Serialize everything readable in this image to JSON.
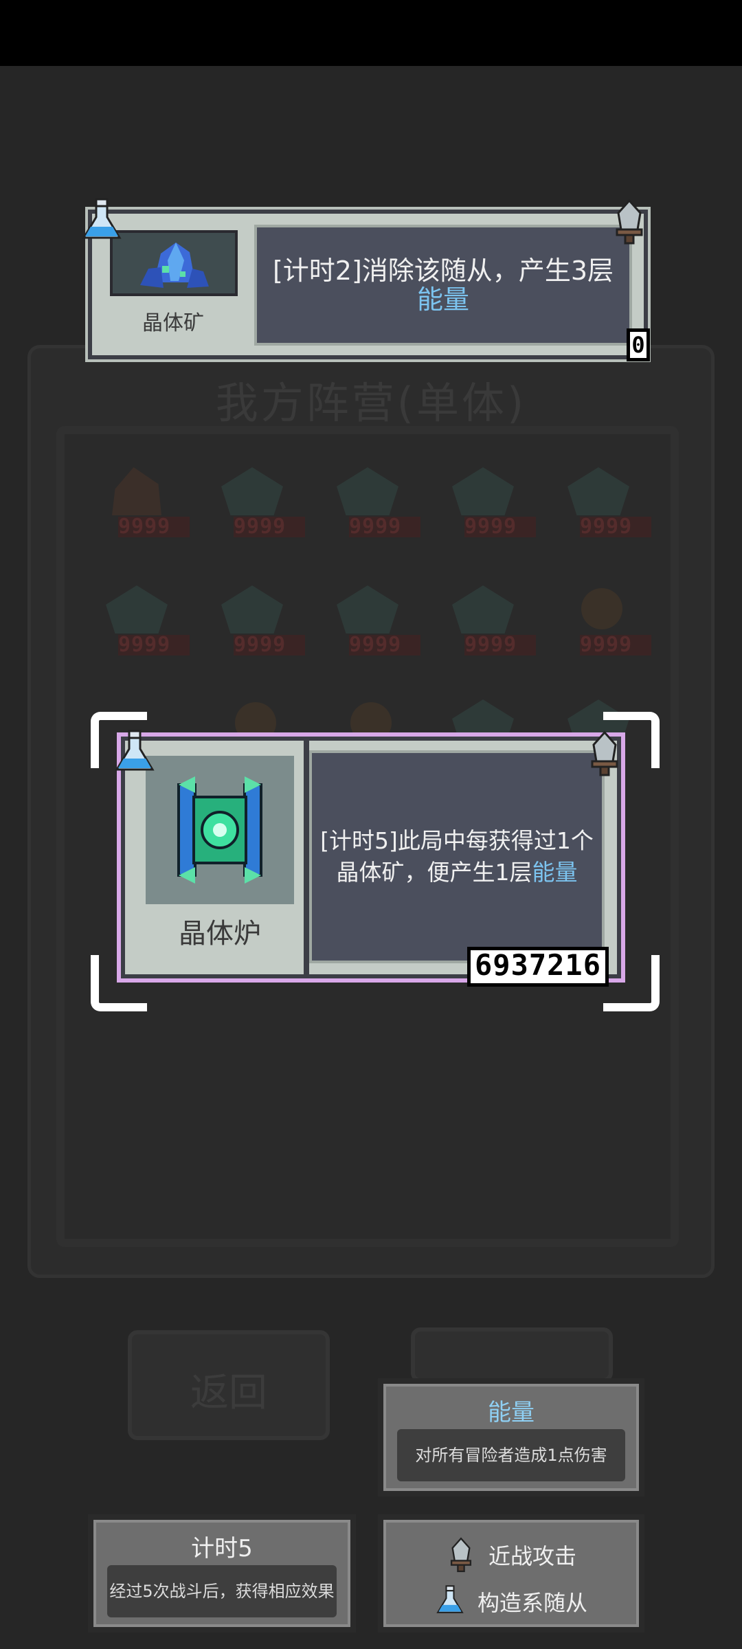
{
  "background": {
    "panel_title": "我方阵营(单体)",
    "ghost_number": "9999",
    "back_button": "返回"
  },
  "top_card": {
    "name": "晶体矿",
    "description_prefix": "[计时2]消除该随从，产生3层",
    "description_highlight": "能量",
    "counter": "0"
  },
  "main_card": {
    "name": "晶体炉",
    "description_prefix": "[计时5]此局中每获得过1个晶体矿，便产生1层",
    "description_highlight": "能量",
    "counter": "6937216"
  },
  "tooltips": {
    "energy": {
      "title": "能量",
      "body": "对所有冒险者造成1点伤害"
    },
    "timer": {
      "title": "计时5",
      "body": "经过5次战斗后，获得相应效果"
    },
    "tags": [
      {
        "icon": "dagger-icon",
        "label": "近战攻击"
      },
      {
        "icon": "flask-icon",
        "label": "构造系随从"
      }
    ]
  },
  "colors": {
    "highlight": "#7cc4f0",
    "card_frame": "#c4ccc6",
    "selection_glow": "#d8a8e8"
  }
}
